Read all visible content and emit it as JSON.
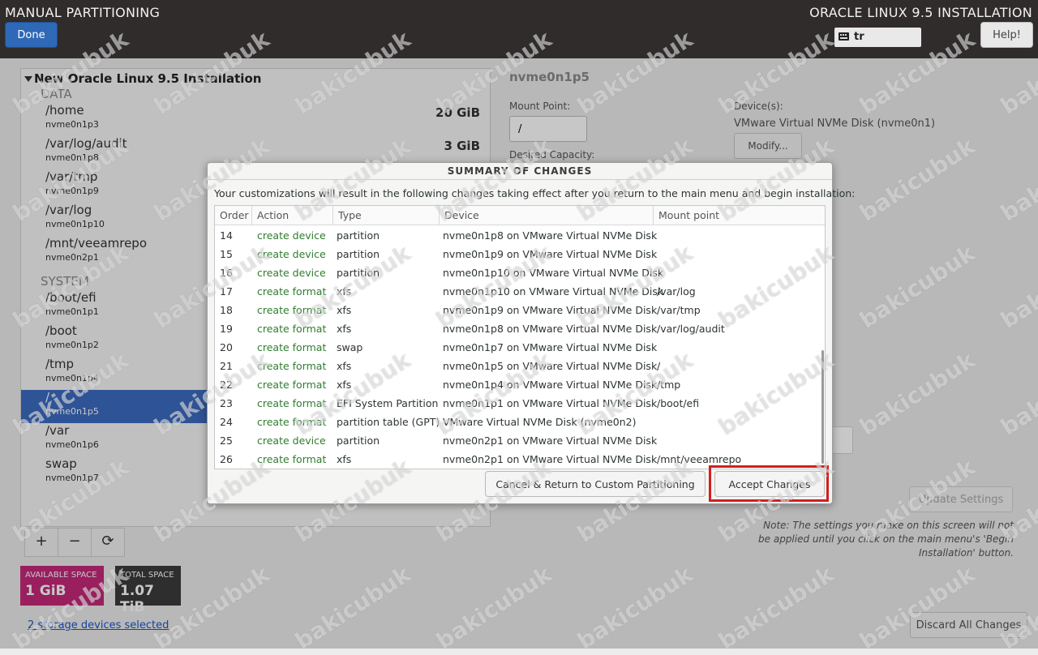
{
  "header": {
    "title": "MANUAL PARTITIONING",
    "done_label": "Done",
    "install_title": "ORACLE LINUX 9.5 INSTALLATION",
    "keyboard_layout": "tr",
    "help_label": "Help!"
  },
  "left_panel": {
    "tree_title": "New Oracle Linux 9.5 Installation",
    "data_section": "DATA",
    "system_section": "SYSTEM",
    "data_mounts": [
      {
        "mount": "/home",
        "device": "nvme0n1p3",
        "size": "20 GiB"
      },
      {
        "mount": "/var/log/audit",
        "device": "nvme0n1p8",
        "size": "3 GiB"
      },
      {
        "mount": "/var/tmp",
        "device": "nvme0n1p9"
      },
      {
        "mount": "/var/log",
        "device": "nvme0n1p10"
      },
      {
        "mount": "/mnt/veeamrepo",
        "device": "nvme0n2p1"
      }
    ],
    "system_mounts": [
      {
        "mount": "/boot/efi",
        "device": "nvme0n1p1"
      },
      {
        "mount": "/boot",
        "device": "nvme0n1p2"
      },
      {
        "mount": "/tmp",
        "device": "nvme0n1p4"
      },
      {
        "mount": "/",
        "device": "nvme0n1p5",
        "selected": true
      },
      {
        "mount": "/var",
        "device": "nvme0n1p6"
      },
      {
        "mount": "swap",
        "device": "nvme0n1p7"
      }
    ],
    "toolbar": {
      "add": "+",
      "remove": "−",
      "refresh": "⟳"
    }
  },
  "space": {
    "available_label": "AVAILABLE SPACE",
    "available_value": "1 GiB",
    "total_label": "TOTAL SPACE",
    "total_value": "1.07 TiB",
    "storage_link": "2 storage devices selected"
  },
  "right_panel": {
    "title": "nvme0n1p5",
    "mount_point_label": "Mount Point:",
    "mount_point_value": "/",
    "desired_capacity_label": "Desired Capacity:",
    "devices_label": "Device(s):",
    "devices_value": "VMware Virtual NVMe Disk (nvme0n1)",
    "modify_label": "Modify...",
    "update_label": "Update Settings",
    "note": "Note:  The settings you make on this screen will not be applied until you click on the main menu's 'Begin Installation' button.",
    "discard_label": "Discard All Changes"
  },
  "dialog": {
    "title": "SUMMARY OF CHANGES",
    "intro": "Your customizations will result in the following changes taking effect after you return to the main menu and begin installation:",
    "columns": [
      "Order",
      "Action",
      "Type",
      "Device",
      "Mount point"
    ],
    "rows": [
      {
        "order": "14",
        "action": "create device",
        "type": "partition",
        "device": "nvme0n1p8 on VMware Virtual NVMe Disk",
        "mount": ""
      },
      {
        "order": "15",
        "action": "create device",
        "type": "partition",
        "device": "nvme0n1p9 on VMware Virtual NVMe Disk",
        "mount": ""
      },
      {
        "order": "16",
        "action": "create device",
        "type": "partition",
        "device": "nvme0n1p10 on VMware Virtual NVMe Disk",
        "mount": ""
      },
      {
        "order": "17",
        "action": "create format",
        "type": "xfs",
        "device": "nvme0n1p10 on VMware Virtual NVMe Disk",
        "mount": "/var/log"
      },
      {
        "order": "18",
        "action": "create format",
        "type": "xfs",
        "device": "nvme0n1p9 on VMware Virtual NVMe Disk",
        "mount": "/var/tmp"
      },
      {
        "order": "19",
        "action": "create format",
        "type": "xfs",
        "device": "nvme0n1p8 on VMware Virtual NVMe Disk",
        "mount": "/var/log/audit"
      },
      {
        "order": "20",
        "action": "create format",
        "type": "swap",
        "device": "nvme0n1p7 on VMware Virtual NVMe Disk",
        "mount": ""
      },
      {
        "order": "21",
        "action": "create format",
        "type": "xfs",
        "device": "nvme0n1p5 on VMware Virtual NVMe Disk",
        "mount": "/"
      },
      {
        "order": "22",
        "action": "create format",
        "type": "xfs",
        "device": "nvme0n1p4 on VMware Virtual NVMe Disk",
        "mount": "/tmp"
      },
      {
        "order": "23",
        "action": "create format",
        "type": "EFI System Partition",
        "device": "nvme0n1p1 on VMware Virtual NVMe Disk",
        "mount": "/boot/efi"
      },
      {
        "order": "24",
        "action": "create format",
        "type": "partition table (GPT)",
        "device": "VMware Virtual NVMe Disk (nvme0n2)",
        "mount": ""
      },
      {
        "order": "25",
        "action": "create device",
        "type": "partition",
        "device": "nvme0n2p1 on VMware Virtual NVMe Disk",
        "mount": ""
      },
      {
        "order": "26",
        "action": "create format",
        "type": "xfs",
        "device": "nvme0n2p1 on VMware Virtual NVMe Disk",
        "mount": "/mnt/veeamrepo"
      }
    ],
    "cancel_label": "Cancel & Return to Custom Partitioning",
    "accept_label": "Accept Changes"
  },
  "watermark": "bakicubuk",
  "colors": {
    "header_bg": "#2f2c2b",
    "accent": "#2f68b7",
    "selection": "#3c6bc0",
    "available_space": "#c4287a",
    "action_text": "#2f7d2f",
    "highlight": "#d21f1f"
  }
}
